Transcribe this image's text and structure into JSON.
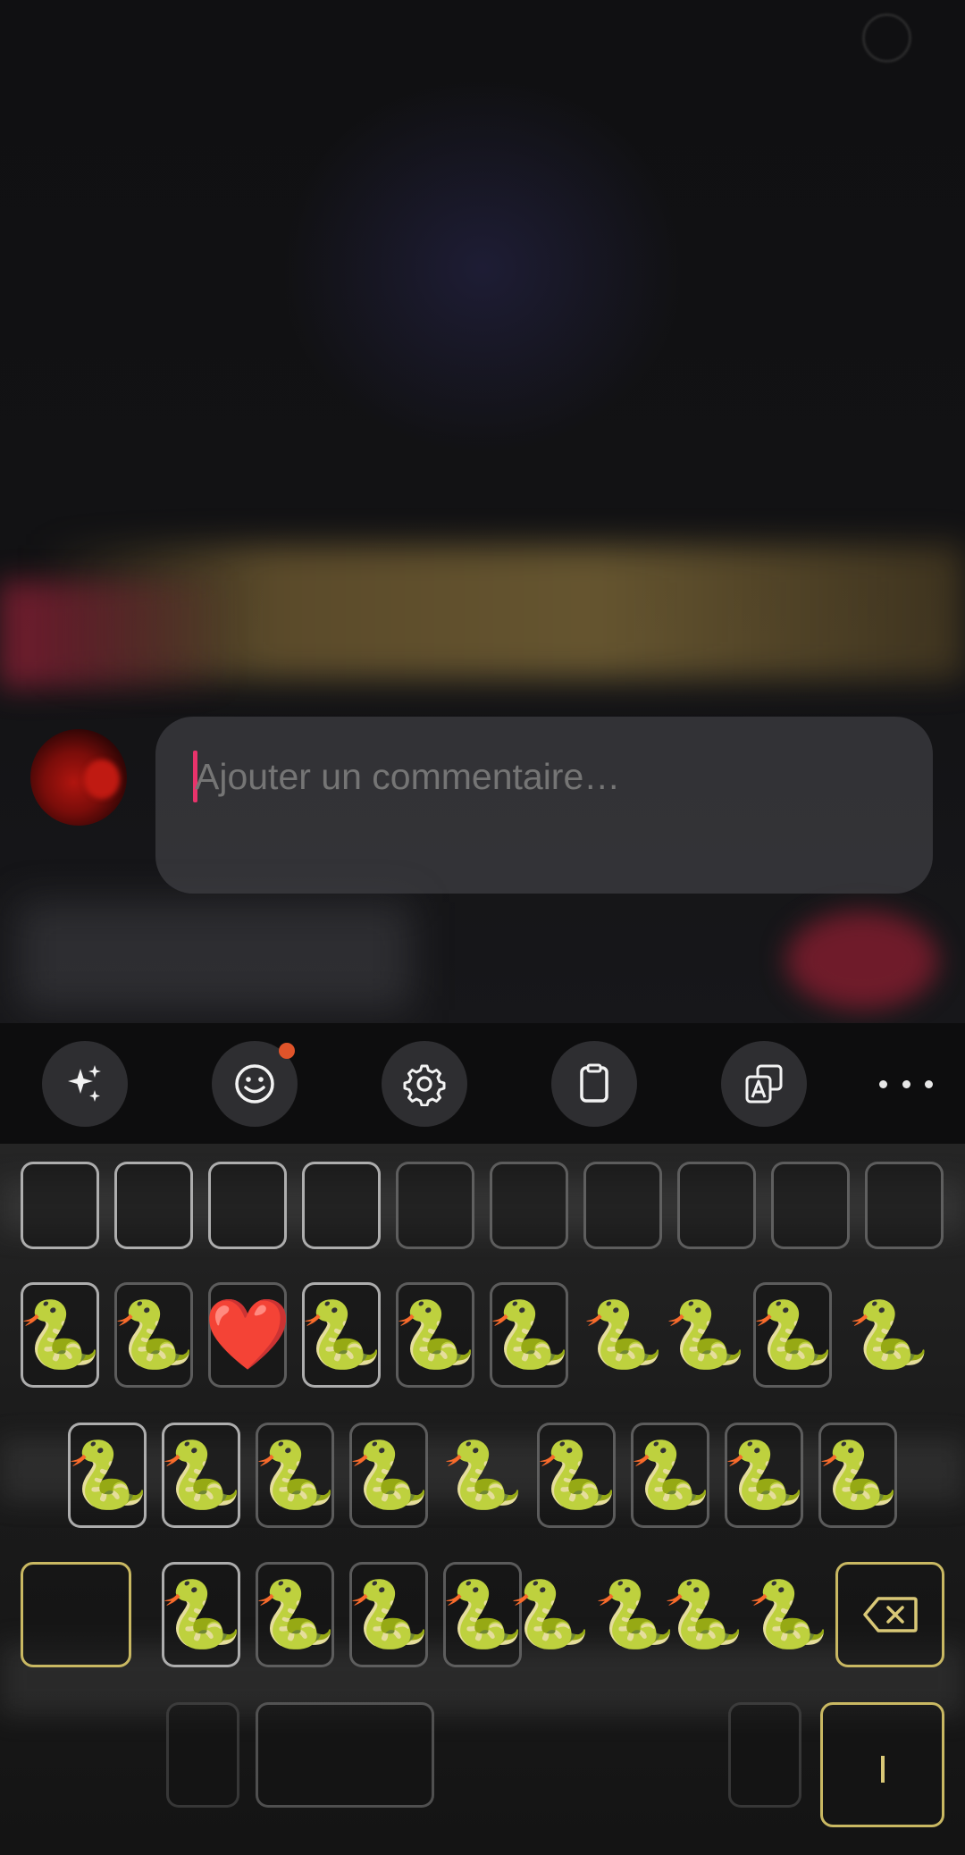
{
  "comment": {
    "placeholder": "Ajouter un commentaire…",
    "value": ""
  },
  "toolbar": {
    "items": [
      {
        "name": "ai-sparkle",
        "icon": "sparkles-icon"
      },
      {
        "name": "emoji",
        "icon": "smiley-icon",
        "has_notification": true
      },
      {
        "name": "settings",
        "icon": "gear-icon"
      },
      {
        "name": "clipboard",
        "icon": "clipboard-icon"
      },
      {
        "name": "translate",
        "icon": "translate-icon"
      },
      {
        "name": "more",
        "icon": "more-dots-icon"
      }
    ]
  },
  "keyboard": {
    "row2": [
      "🐍",
      "🐍",
      "❤️",
      "🐍",
      "🐍",
      "🐍",
      "🐍",
      "🐍",
      "🐍",
      "🐍"
    ],
    "row3": [
      "🐍",
      "🐍",
      "🐍",
      "🐍",
      "🐍",
      "🐍",
      "🐍",
      "🐍",
      "🐍"
    ],
    "row4": [
      "🐍",
      "🐍",
      "🐍",
      "🐍",
      "🐍",
      "🐍",
      "🐍",
      "🐍"
    ],
    "accent_color": "#c9b862"
  }
}
